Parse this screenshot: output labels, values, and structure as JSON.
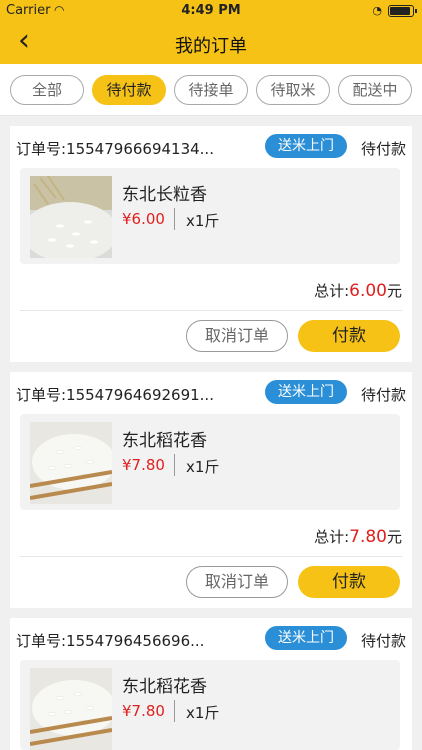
{
  "status_bar": {
    "carrier": "Carrier",
    "time": "4:49 PM"
  },
  "header": {
    "title": "我的订单",
    "back_icon": "chevron-left-icon"
  },
  "tabs": [
    {
      "label": "全部",
      "active": false
    },
    {
      "label": "待付款",
      "active": true
    },
    {
      "label": "待接单",
      "active": false
    },
    {
      "label": "待取米",
      "active": false
    },
    {
      "label": "配送中",
      "active": false
    }
  ],
  "orders": [
    {
      "order_no": "订单号:15547966694134...",
      "badge": "送米上门",
      "status": "待付款",
      "item": {
        "name": "东北长粒香",
        "price": "¥6.00",
        "qty": "x1斤"
      },
      "total_label": "总计:",
      "total_value": "6.00",
      "total_unit": "元",
      "cancel_label": "取消订单",
      "pay_label": "付款"
    },
    {
      "order_no": "订单号:15547964692691...",
      "badge": "送米上门",
      "status": "待付款",
      "item": {
        "name": "东北稻花香",
        "price": "¥7.80",
        "qty": "x1斤"
      },
      "total_label": "总计:",
      "total_value": "7.80",
      "total_unit": "元",
      "cancel_label": "取消订单",
      "pay_label": "付款"
    },
    {
      "order_no": "订单号:1554796456696...",
      "badge": "送米上门",
      "status": "待付款",
      "item": {
        "name": "东北稻花香",
        "price": "¥7.80",
        "qty": "x1斤"
      }
    }
  ],
  "colors": {
    "accent": "#f6c216",
    "price": "#e02020",
    "badge": "#2a8fd6"
  }
}
